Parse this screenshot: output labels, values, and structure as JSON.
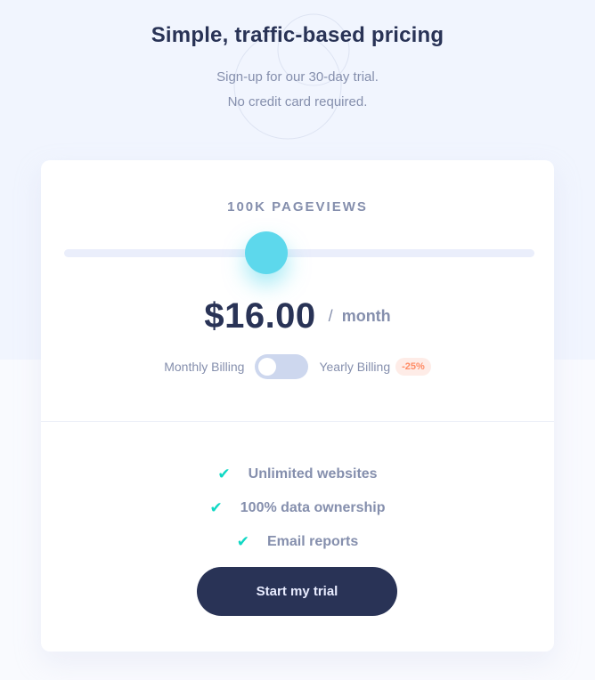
{
  "header": {
    "title": "Simple, traffic-based pricing",
    "subtitle_line1": "Sign-up for our 30-day trial.",
    "subtitle_line2": "No credit card required."
  },
  "pricing": {
    "pageviews_label": "100K PAGEVIEWS",
    "slider_level": 0.43,
    "price": "$16.00",
    "separator": "/",
    "period": "month"
  },
  "billing": {
    "monthly_label": "Monthly Billing",
    "yearly_label": "Yearly Billing",
    "discount_badge": "-25%",
    "yearly_enabled": false
  },
  "features": [
    {
      "icon": "check-icon",
      "label": "Unlimited websites"
    },
    {
      "icon": "check-icon",
      "label": "100% data ownership"
    },
    {
      "icon": "check-icon",
      "label": "Email reports"
    }
  ],
  "cta": {
    "label": "Start my trial"
  },
  "colors": {
    "accent": "#5dd8ec",
    "dark": "#293356",
    "muted": "#858fad",
    "check": "#10d8c4",
    "discount": "#ff8c66"
  }
}
